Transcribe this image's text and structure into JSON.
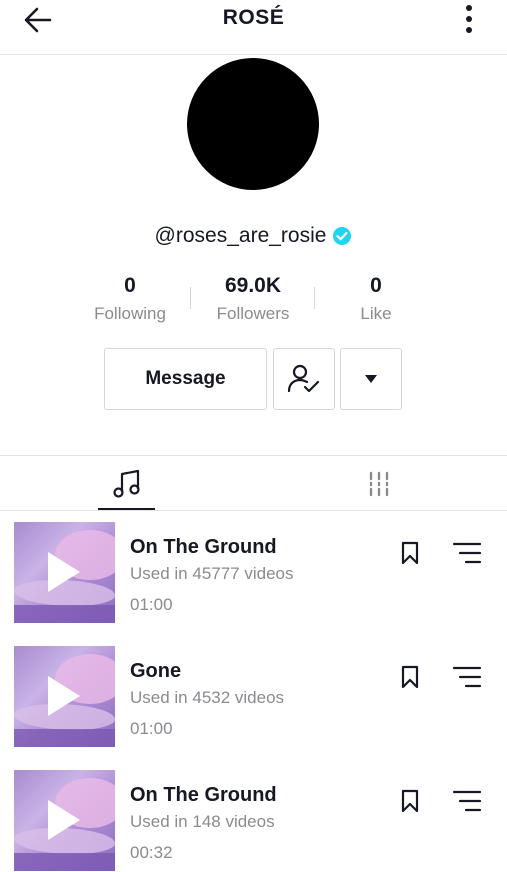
{
  "header": {
    "title": "ROSÉ",
    "back_icon": "arrow-left-icon",
    "more_icon": "more-vertical-icon"
  },
  "profile": {
    "username": "@roses_are_rosie",
    "verified": true,
    "verified_color": "#20d5ec"
  },
  "stats": [
    {
      "value": "0",
      "label": "Following"
    },
    {
      "value": "69.0K",
      "label": "Followers"
    },
    {
      "value": "0",
      "label": "Like"
    }
  ],
  "actions": {
    "message_label": "Message",
    "friend_icon": "user-check-icon",
    "dropdown_icon": "caret-down-icon"
  },
  "tabs": [
    {
      "name": "music",
      "icon": "music-note-icon",
      "active": true
    },
    {
      "name": "videos",
      "icon": "columns-icon",
      "active": false
    }
  ],
  "tracks": [
    {
      "title": "On The Ground",
      "used": "Used in 45777 videos",
      "duration": "01:00"
    },
    {
      "title": "Gone",
      "used": "Used in 4532 videos",
      "duration": "01:00"
    },
    {
      "title": "On The Ground",
      "used": "Used in 148 videos",
      "duration": "00:32"
    }
  ]
}
